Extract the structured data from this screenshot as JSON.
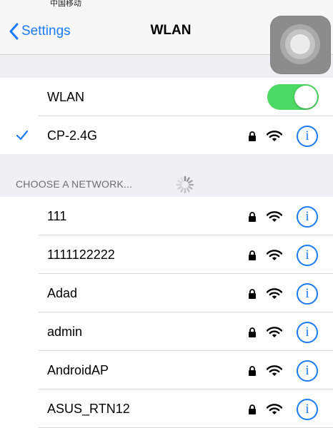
{
  "status_bar": {
    "fragment": "中国移动"
  },
  "navbar": {
    "back_label": "Settings",
    "title": "WLAN"
  },
  "wlan_row": {
    "label": "WLAN",
    "enabled": true
  },
  "connected": {
    "name": "CP-2.4G",
    "secured": true,
    "info_glyph": "i"
  },
  "section": {
    "header": "CHOOSE A NETWORK..."
  },
  "networks": [
    {
      "name": "111",
      "secured": true,
      "info_glyph": "i"
    },
    {
      "name": "1111122222",
      "secured": true,
      "info_glyph": "i"
    },
    {
      "name": "Adad",
      "secured": true,
      "info_glyph": "i"
    },
    {
      "name": "admin",
      "secured": true,
      "info_glyph": "i"
    },
    {
      "name": "AndroidAP",
      "secured": true,
      "info_glyph": "i"
    },
    {
      "name": "ASUS_RTN12",
      "secured": true,
      "info_glyph": "i"
    }
  ],
  "colors": {
    "accent": "#1a7bf7",
    "toggle_on": "#4cd964",
    "group_bg": "#efeff4"
  },
  "icons": [
    "chevron-left-icon",
    "assistive-touch-icon",
    "checkmark-icon",
    "lock-icon",
    "wifi-icon",
    "info-icon",
    "spinner-icon"
  ]
}
